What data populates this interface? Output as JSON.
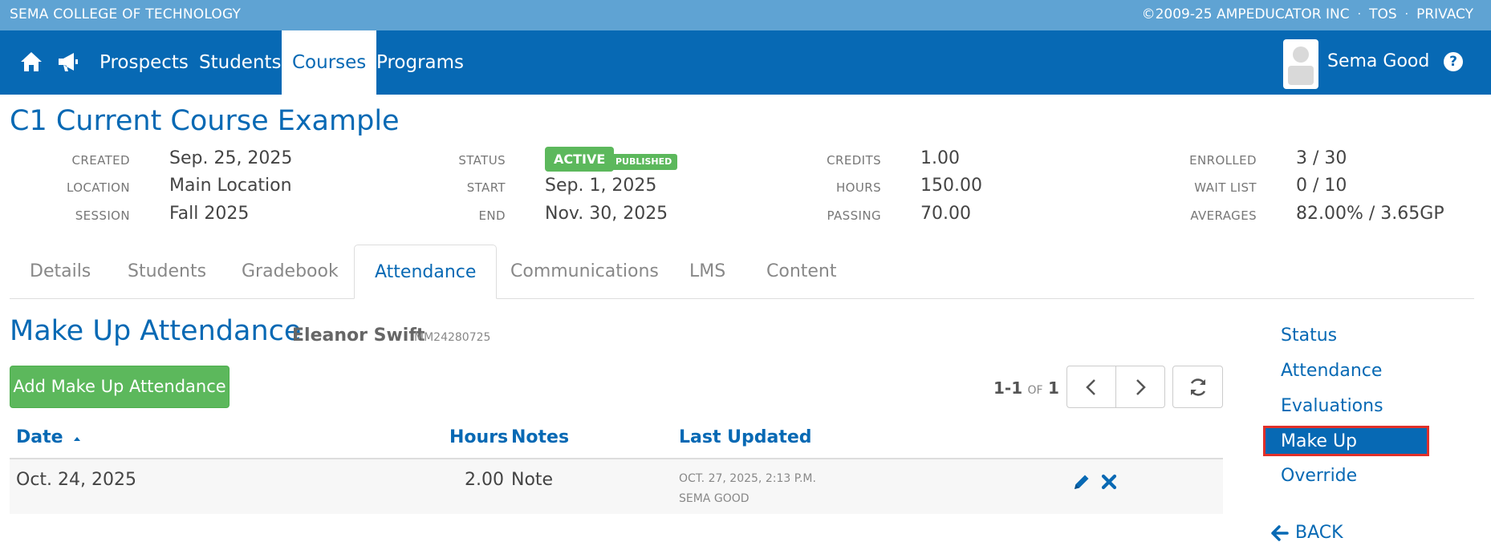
{
  "topbar": {
    "school": "SEMA COLLEGE OF TECHNOLOGY",
    "copyright": "©2009-25 AMPEDUCATOR INC",
    "tos": "TOS",
    "privacy": "PRIVACY",
    "separator": "·"
  },
  "nav": {
    "icons": [
      "home-icon",
      "megaphone-icon"
    ],
    "items": [
      "Prospects",
      "Students",
      "Courses",
      "Programs"
    ],
    "active": "Courses",
    "user": "Sema Good",
    "help": "?"
  },
  "course": {
    "title": "C1 Current Course Example",
    "created_label": "CREATED",
    "created": "Sep. 25, 2025",
    "location_label": "LOCATION",
    "location": "Main Location",
    "session_label": "SESSION",
    "session": "Fall 2025",
    "status_label": "STATUS",
    "status": "ACTIVE",
    "published": "PUBLISHED",
    "start_label": "START",
    "start": "Sep. 1, 2025",
    "end_label": "END",
    "end": "Nov. 30, 2025",
    "credits_label": "CREDITS",
    "credits": "1.00",
    "hours_label": "HOURS",
    "hours": "150.00",
    "passing_label": "PASSING",
    "passing": "70.00",
    "enrolled_label": "ENROLLED",
    "enrolled": "3 / 30",
    "waitlist_label": "WAIT LIST",
    "waitlist": "0 / 10",
    "averages_label": "AVERAGES",
    "averages": "82.00% / 3.65GP"
  },
  "tabs": [
    "Details",
    "Students",
    "Gradebook",
    "Attendance",
    "Communications",
    "LMS",
    "Content"
  ],
  "active_tab": "Attendance",
  "section": {
    "title": "Make Up Attendance",
    "student_name": "Eleanor Swift",
    "student_id": "MM24280725",
    "add_button": "Add Make Up Attendance"
  },
  "pager": {
    "range": "1-1",
    "of": "OF",
    "total": "1"
  },
  "table": {
    "headers": {
      "date": "Date",
      "hours": "Hours",
      "notes": "Notes",
      "last_updated": "Last Updated"
    },
    "rows": [
      {
        "date": "Oct. 24, 2025",
        "hours": "2.00",
        "notes": "Note",
        "updated_at": "OCT. 27, 2025, 2:13 P.M.",
        "updated_by": "SEMA GOOD"
      }
    ]
  },
  "side_menu": {
    "items": [
      "Status",
      "Attendance",
      "Evaluations",
      "Make Up",
      "Override"
    ],
    "active": "Make Up",
    "back": "BACK"
  },
  "colors": {
    "brand": "#0769b4",
    "topbar": "#5fa3d3",
    "success": "#5cb85c",
    "highlight": "#e0302a"
  }
}
